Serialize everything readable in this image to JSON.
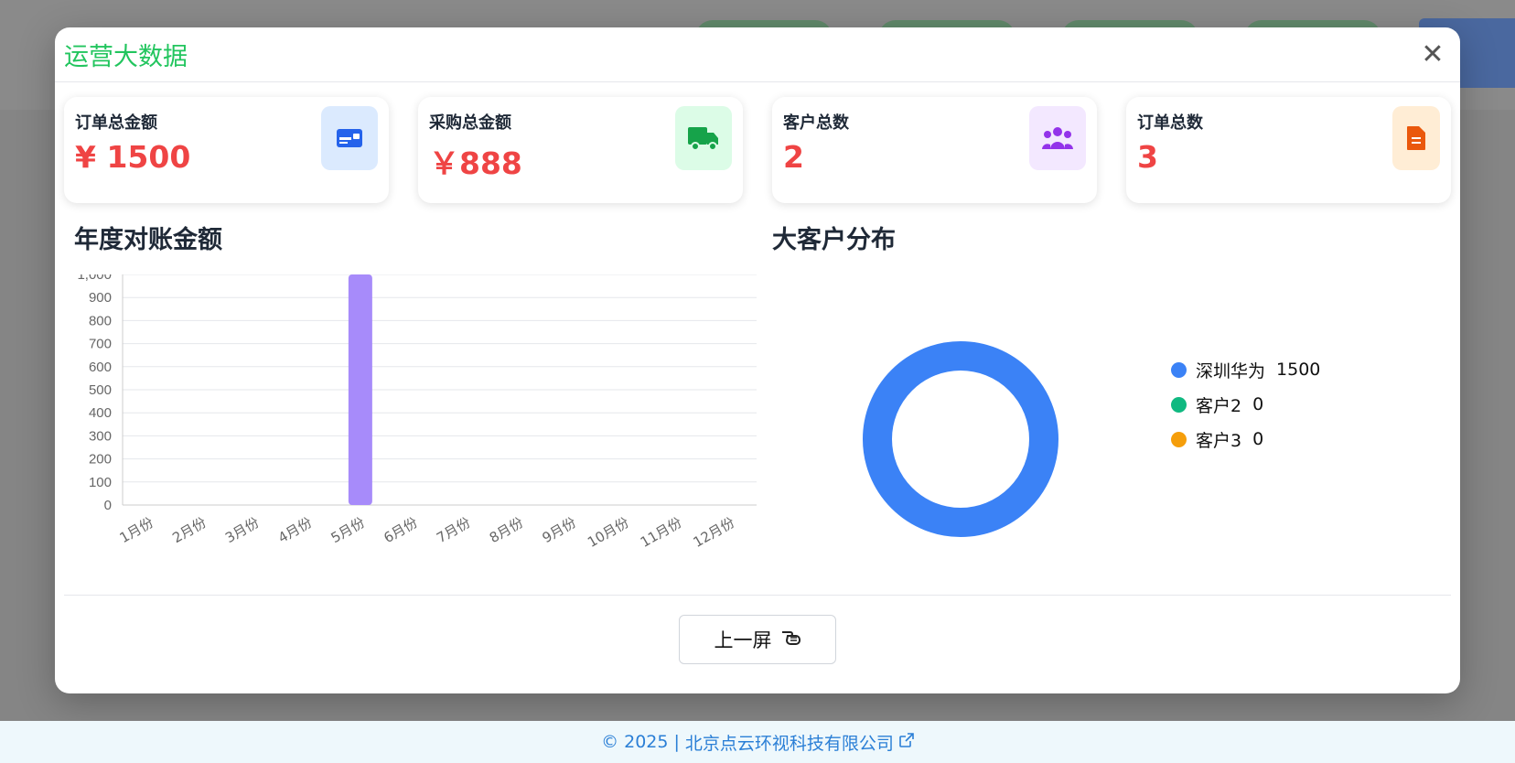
{
  "modal": {
    "title": "运营大数据",
    "close_label": "✕"
  },
  "cards": [
    {
      "label": "订单总金额",
      "value": "¥ 1500",
      "icon": "id-card-icon"
    },
    {
      "label": "采购总金额",
      "value": "￥888",
      "icon": "truck-icon"
    },
    {
      "label": "客户总数",
      "value": "2",
      "icon": "users-icon"
    },
    {
      "label": "订单总数",
      "value": "3",
      "icon": "document-icon"
    }
  ],
  "sections": {
    "bar_title": "年度对账金额",
    "pie_title": "大客户分布"
  },
  "chart_data": [
    {
      "type": "bar",
      "title": "年度对账金额",
      "categories": [
        "1月份",
        "2月份",
        "3月份",
        "4月份",
        "5月份",
        "6月份",
        "7月份",
        "8月份",
        "9月份",
        "10月份",
        "11月份",
        "12月份"
      ],
      "values": [
        0,
        0,
        0,
        0,
        1000,
        0,
        0,
        0,
        0,
        0,
        0,
        0
      ],
      "ylim": [
        0,
        1000
      ],
      "yticks": [
        "0",
        "100",
        "200",
        "300",
        "400",
        "500",
        "600",
        "700",
        "800",
        "900",
        "1,000"
      ],
      "color": "#a78bfa",
      "grid": true
    },
    {
      "type": "pie",
      "title": "大客户分布",
      "labels": [
        "深圳华为",
        "客户2",
        "客户3"
      ],
      "values": [
        1500,
        0,
        0
      ],
      "colors": [
        "#3b82f6",
        "#10b981",
        "#f59e0b"
      ],
      "donut": true,
      "legend": "right"
    }
  ],
  "prev_button": {
    "label": "上一屏"
  },
  "footer": {
    "copyright": "© 2025",
    "separator": "|",
    "company": "北京点云环视科技有限公司"
  }
}
